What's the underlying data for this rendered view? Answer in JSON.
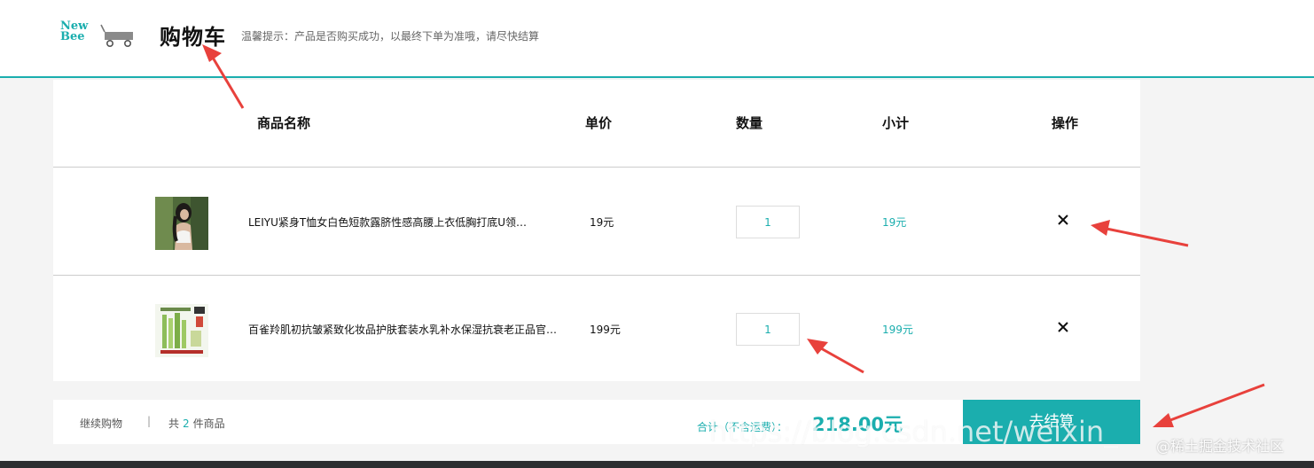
{
  "header": {
    "logo_line1": "New",
    "logo_line2": "Bee",
    "title": "购物车",
    "tip": "温馨提示：产品是否购买成功，以最终下单为准哦，请尽快结算"
  },
  "table": {
    "columns": [
      "商品名称",
      "单价",
      "数量",
      "小计",
      "操作"
    ]
  },
  "items": [
    {
      "name": "LEIYU紧身T恤女白色短款露脐性感高腰上衣低胸打底U领…",
      "price": "19元",
      "quantity": "1",
      "subtotal": "19元",
      "delete_icon": "close-icon"
    },
    {
      "name": "百雀羚肌初抗皱紧致化妆品护肤套装水乳补水保湿抗衰老正品官…",
      "price": "199元",
      "quantity": "1",
      "subtotal": "199元",
      "delete_icon": "close-icon"
    }
  ],
  "footer": {
    "continue_label": "继续购物",
    "separator": "|",
    "count_prefix": "共",
    "count": "2",
    "count_suffix": "件商品",
    "total_label": "合计（不含运费）：",
    "total_value": "218.00元",
    "checkout_label": "去结算"
  },
  "watermarks": {
    "url_text": "https://blog.csdn.net/weixin_",
    "site_text": "@稀土掘金技术社区"
  },
  "colors": {
    "accent": "#1baeae",
    "arrow": "#e8413c"
  }
}
